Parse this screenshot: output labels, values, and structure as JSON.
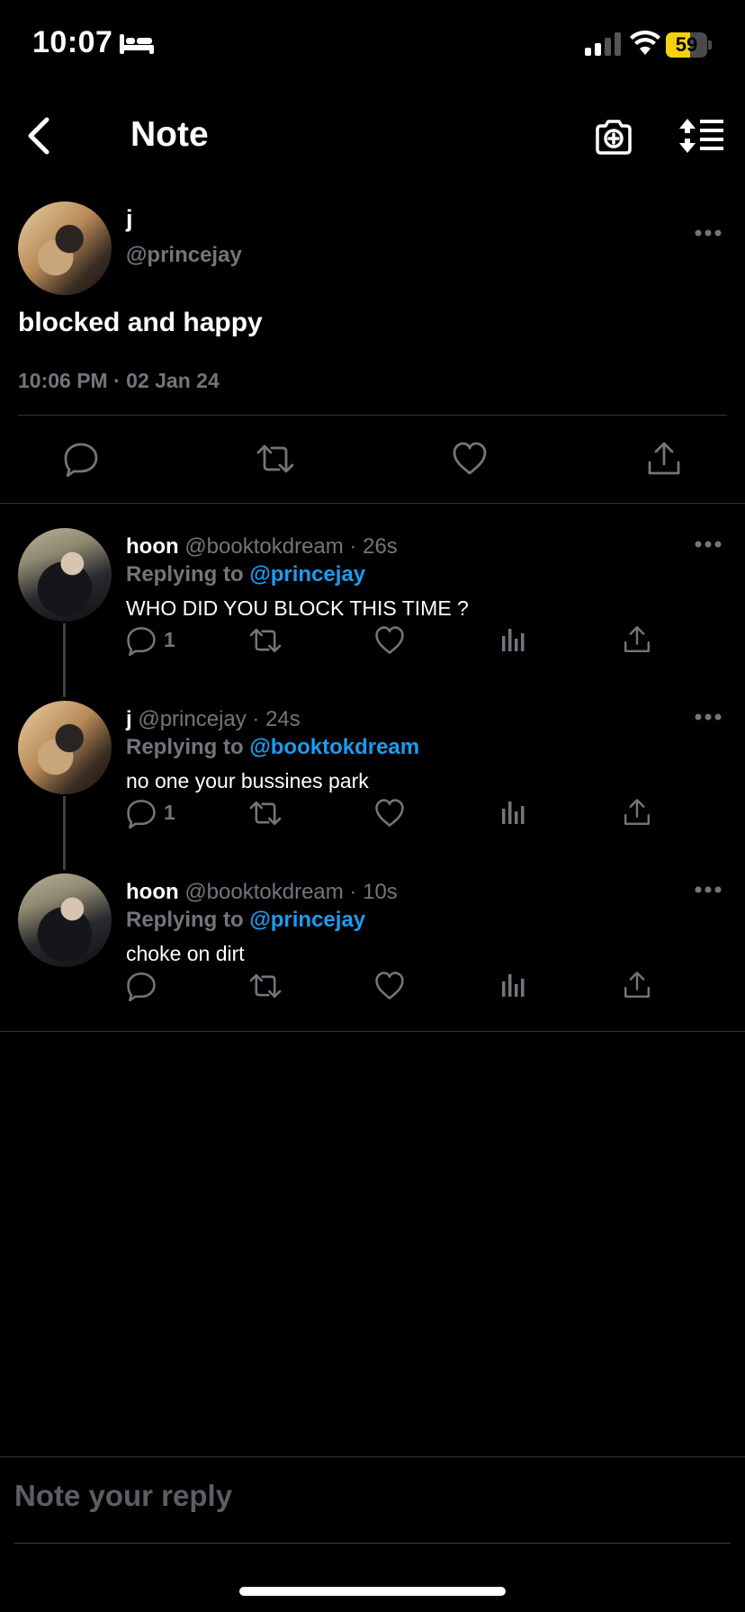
{
  "status_bar": {
    "time": "10:07",
    "battery": "59",
    "battery_level": 0.59
  },
  "header": {
    "title": "Note"
  },
  "post": {
    "name": "j",
    "handle": "@princejay",
    "text": "blocked and happy",
    "timestamp": "10:06 PM · 02 Jan 24"
  },
  "replies": [
    {
      "name": "hoon",
      "meta": "@booktokdream · 26s",
      "replying_prefix": "Replying to ",
      "replying_to": "@princejay",
      "text": "WHO DID YOU BLOCK THIS TIME ?",
      "reply_count": "1"
    },
    {
      "name": "j",
      "meta": "@princejay · 24s",
      "replying_prefix": "Replying to ",
      "replying_to": "@booktokdream",
      "text": "no one your bussines park",
      "reply_count": "1"
    },
    {
      "name": "hoon",
      "meta": "@booktokdream · 10s",
      "replying_prefix": "Replying to ",
      "replying_to": "@princejay",
      "text": "choke on dirt",
      "reply_count": ""
    }
  ],
  "reply_bar": {
    "placeholder": "Note your reply"
  },
  "colors": {
    "accent": "#1d9bf0",
    "muted": "#71767b",
    "battery": "#f5d20f"
  }
}
